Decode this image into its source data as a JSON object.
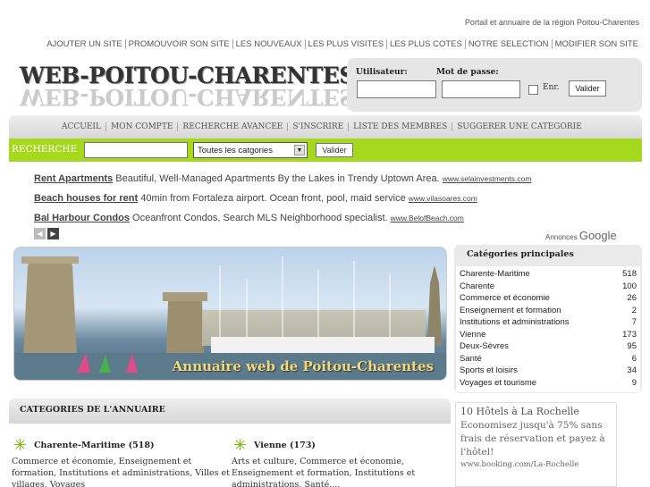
{
  "header": {
    "tagline": "Portail et annuaire de la région Poitou-Charentes",
    "top_nav": [
      "AJOUTER UN SITE",
      "PROMOUVOIR SON SITE",
      "LES NOUVEAUX",
      "LES PLUS VISITES",
      "LES PLUS COTES",
      "NOTRE SELECTION",
      "MODIFIER SON SITE"
    ],
    "logo_text": "WEB-POITOU-CHARENTES"
  },
  "login": {
    "user_label": "Utilisateur:",
    "pass_label": "Mot de passe:",
    "remember_label": "Enr.",
    "submit_label": "Valider"
  },
  "main_nav": [
    "ACCUEIL",
    "MON COMPTE",
    "RECHERCHE AVANCEE",
    "S'INSCRIRE",
    "LISTE DES MEMBRES",
    "SUGGERER UNE CATEGORIE"
  ],
  "search": {
    "label": "RECHERCHE",
    "select_value": "Toutes les catgories",
    "submit_label": "Valider"
  },
  "ads": [
    {
      "title": "Rent Apartments",
      "text": "Beautiful, Well-Managed Apartments By the Lakes in Trendy Uptown Area.",
      "url": "www.selainvestments.com"
    },
    {
      "title": "Beach houses for rent",
      "text": "40min from Fortaleza airport. Ocean front, pool, maid service",
      "url": "www.vilasoares.com"
    },
    {
      "title": "Bal Harbour Condos",
      "text": "Oceanfront Condos, Search MLS Neighborhood specialist.",
      "url": "www.BelofBeach.com"
    }
  ],
  "ads_by": {
    "label": "Annonces",
    "brand": "Google"
  },
  "banner_caption": "Annuaire web de Poitou-Charentes",
  "main_categories": {
    "title": "Catégories principales",
    "items": [
      {
        "name": "Charente-Maritime",
        "count": "518"
      },
      {
        "name": "Charente",
        "count": "100"
      },
      {
        "name": "Commerce et économie",
        "count": "26"
      },
      {
        "name": "Enseignement et formation",
        "count": "2"
      },
      {
        "name": "Institutions et administrations",
        "count": "7"
      },
      {
        "name": "Vienne",
        "count": "173"
      },
      {
        "name": "Deux-Sèvres",
        "count": "95"
      },
      {
        "name": "Santé",
        "count": "6"
      },
      {
        "name": "Sports et loisirs",
        "count": "34"
      },
      {
        "name": "Voyages et tourisme",
        "count": "9"
      }
    ]
  },
  "directory": {
    "title": "CATEGORIES DE L'ANNUAIRE",
    "cats": [
      {
        "name": "Charente-Maritime (518)",
        "desc": "Commerce et économie, Enseignement et formation, Institutions et administrations, Villes et villages, Voyages"
      },
      {
        "name": "Vienne (173)",
        "desc": "Arts et culture, Commerce et économie, Enseignement et formation, Institutions et administrations, Santé...."
      }
    ]
  },
  "side_ad": {
    "title": "10 Hôtels à La Rochelle",
    "text": "Economisez jusqu'à 75% sans frais de réservation et payez à l'hôtel!",
    "url": "www.booking.com/La-Rochelle"
  }
}
